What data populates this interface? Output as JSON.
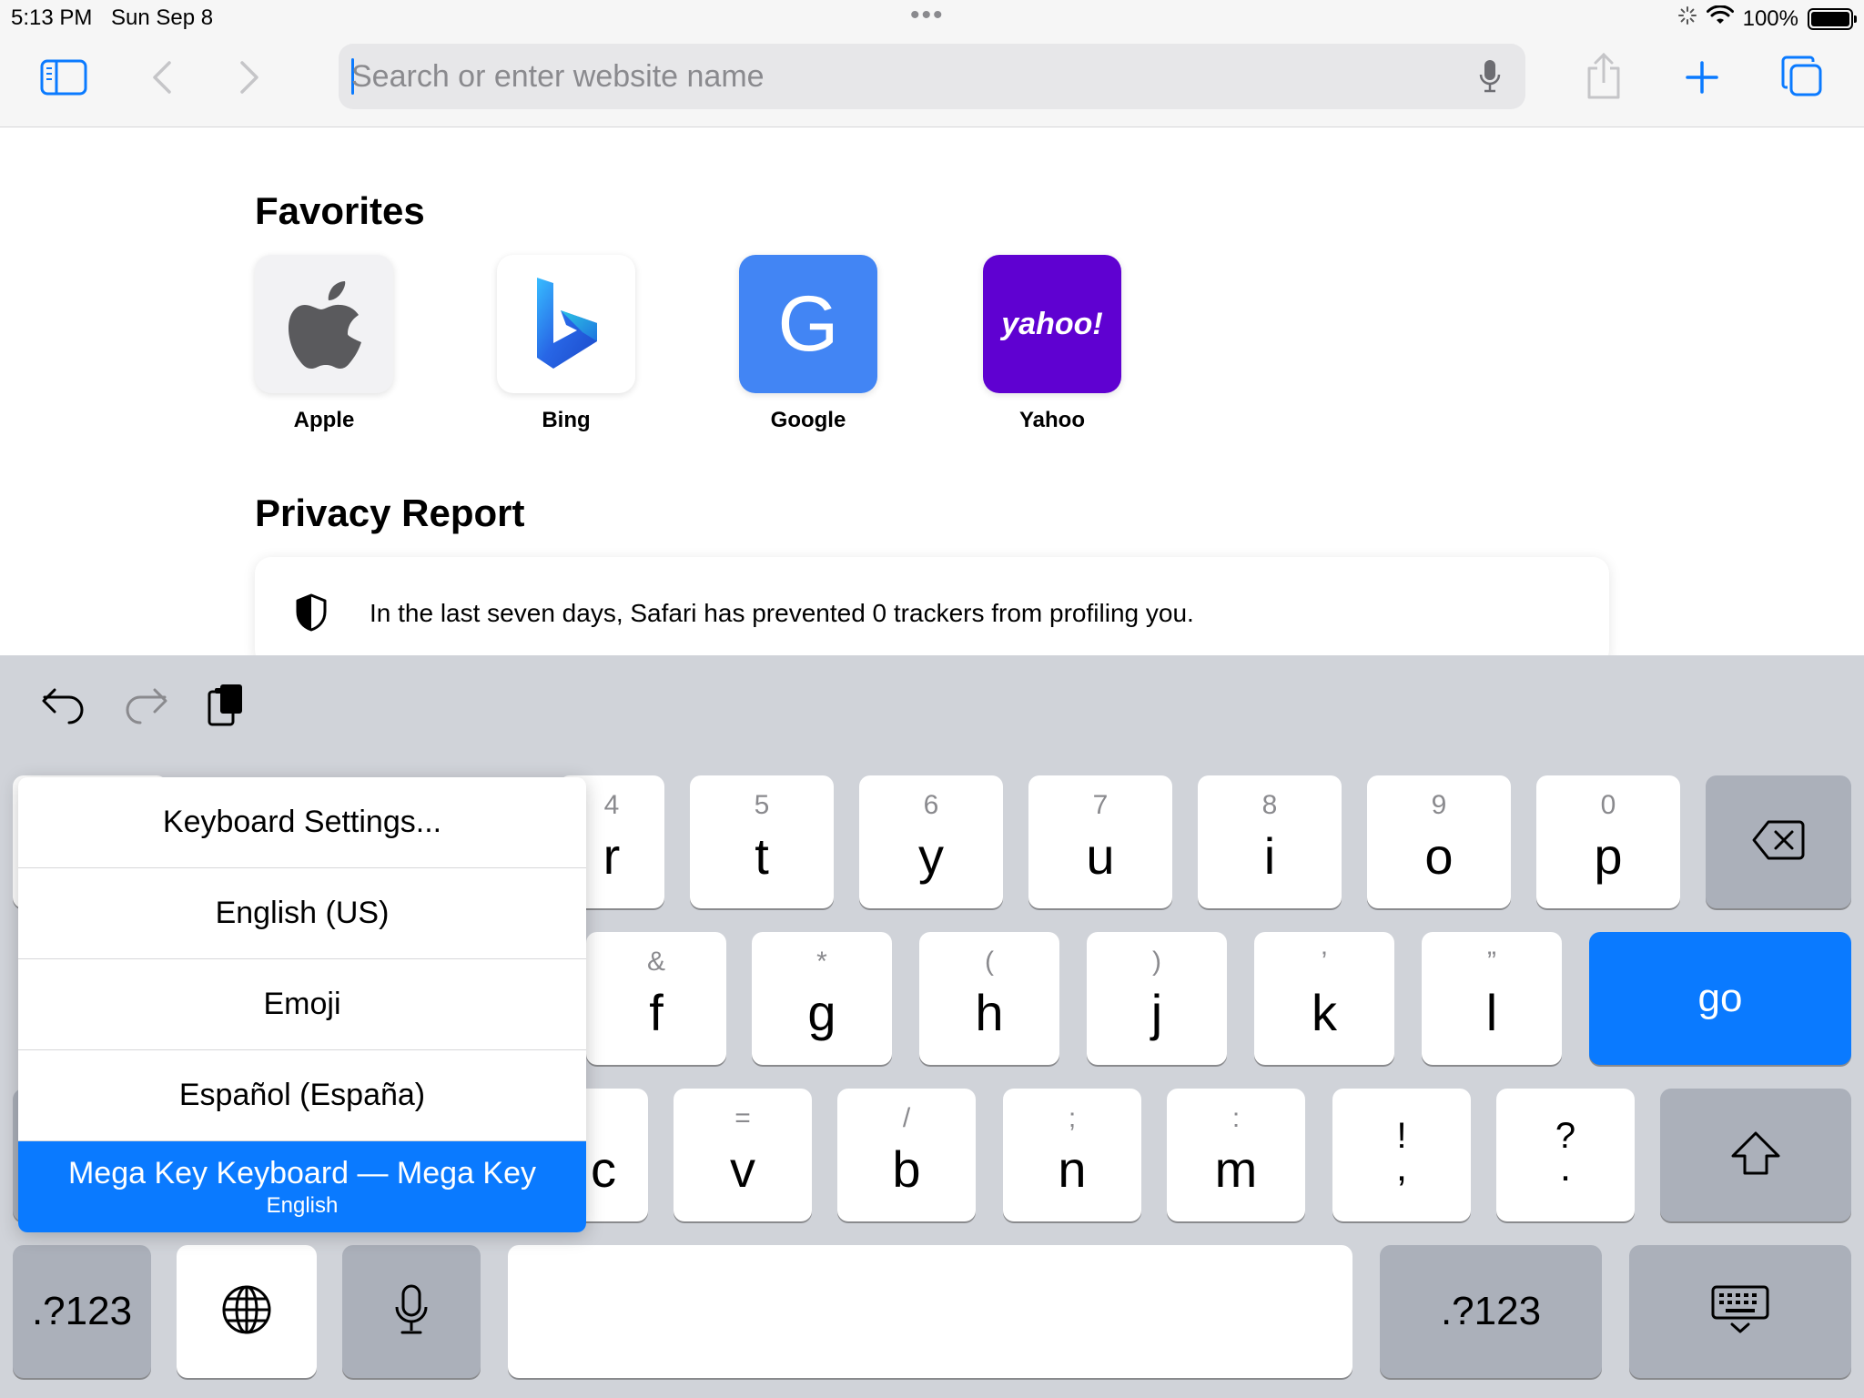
{
  "status_bar": {
    "time": "5:13 PM",
    "date": "Sun Sep 8",
    "dots": "•••",
    "battery": "100%"
  },
  "toolbar": {
    "search_placeholder": "Search or enter website name"
  },
  "favorites": {
    "title": "Favorites",
    "items": [
      {
        "label": "Apple",
        "icon": "apple-logo-icon",
        "bg": "#f2f2f4"
      },
      {
        "label": "Bing",
        "icon": "bing-logo-icon",
        "bg": "#ffffff"
      },
      {
        "label": "Google",
        "icon_text": "G",
        "bg": "#4285f4"
      },
      {
        "label": "Yahoo",
        "icon_text": "yahoo!",
        "bg": "#5f01d1"
      }
    ]
  },
  "privacy_report": {
    "title": "Privacy Report",
    "text": "In the last seven days, Safari has prevented 0 trackers from profiling you."
  },
  "input_menu": {
    "items": [
      "Keyboard Settings...",
      "English (US)",
      "Emoji",
      "Español (España)"
    ],
    "selected": {
      "title": "Mega Key Keyboard — Mega Key",
      "subtitle": "English"
    }
  },
  "keyboard": {
    "row1": [
      {
        "sub": "4",
        "main": "r"
      },
      {
        "sub": "5",
        "main": "t"
      },
      {
        "sub": "6",
        "main": "y"
      },
      {
        "sub": "7",
        "main": "u"
      },
      {
        "sub": "8",
        "main": "i"
      },
      {
        "sub": "9",
        "main": "o"
      },
      {
        "sub": "0",
        "main": "p"
      }
    ],
    "row2": [
      {
        "sub": "&",
        "main": "f"
      },
      {
        "sub": "*",
        "main": "g"
      },
      {
        "sub": "(",
        "main": "h"
      },
      {
        "sub": ")",
        "main": "j"
      },
      {
        "sub": "’",
        "main": "k"
      },
      {
        "sub": "”",
        "main": "l"
      }
    ],
    "row3": [
      {
        "sub": "",
        "main": "c"
      },
      {
        "sub": "=",
        "main": "v"
      },
      {
        "sub": "/",
        "main": "b"
      },
      {
        "sub": ";",
        "main": "n"
      },
      {
        "sub": ":",
        "main": "m"
      },
      {
        "sub": "!",
        "main": ","
      },
      {
        "sub": "?",
        "main": "."
      }
    ],
    "go_label": "go",
    "numbers_left": ".?123",
    "numbers_right": ".?123"
  },
  "colors": {
    "accent": "#0a7aff",
    "keyboard_bg": "#d0d3d9",
    "dark_key": "#abb0ba"
  }
}
